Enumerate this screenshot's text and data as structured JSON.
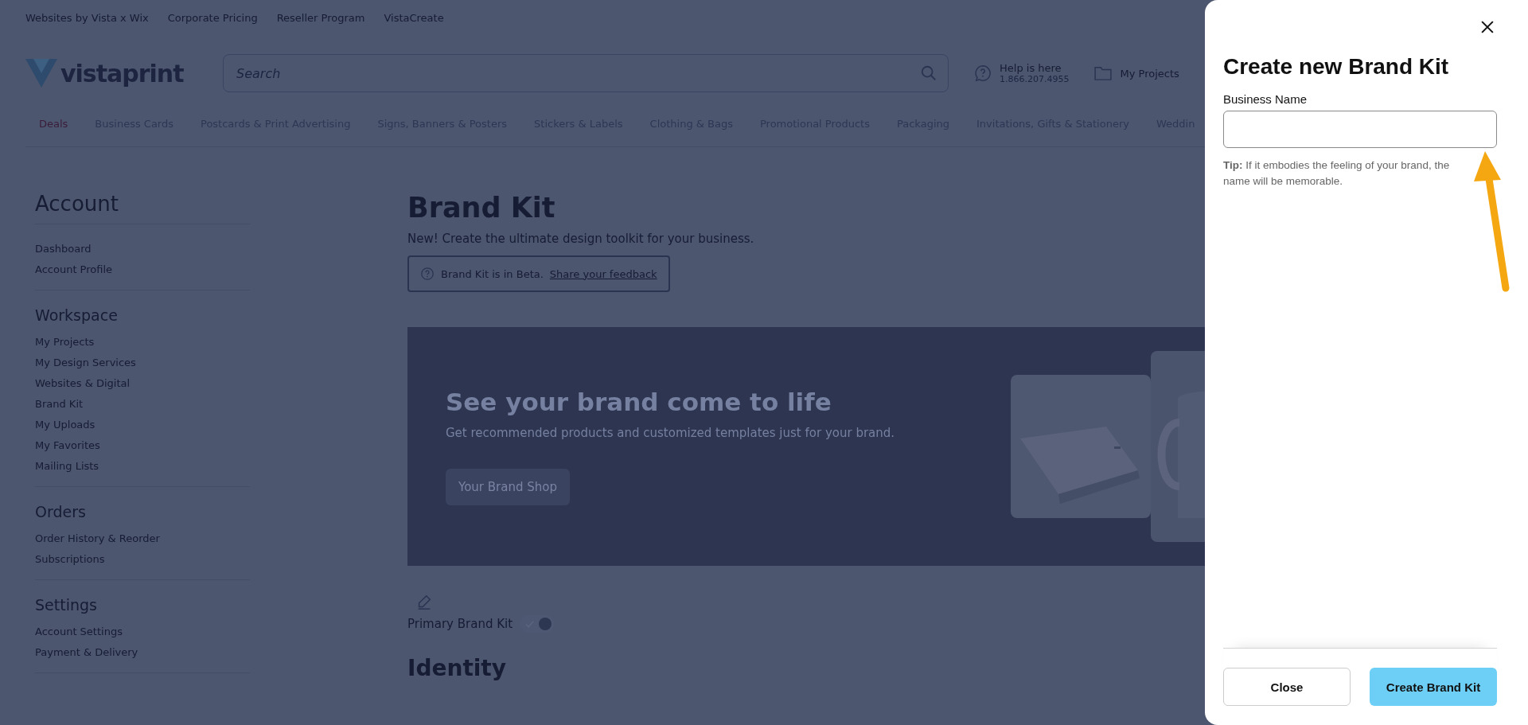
{
  "top_links": [
    "Websites by Vista x Wix",
    "Corporate Pricing",
    "Reseller Program",
    "VistaCreate"
  ],
  "header": {
    "logo": "vistaprint",
    "search": {
      "placeholder": "Search"
    },
    "help": {
      "title": "Help is here",
      "phone": "1.866.207.4955"
    },
    "projects": "My Projects"
  },
  "nav": [
    {
      "label": "Deals",
      "color": "#3a1c3a"
    },
    {
      "label": "Business Cards",
      "color": "#2d3754"
    },
    {
      "label": "Postcards & Print Advertising",
      "color": "#2d3754"
    },
    {
      "label": "Signs, Banners & Posters",
      "color": "#2d3754"
    },
    {
      "label": "Stickers & Labels",
      "color": "#2d3754"
    },
    {
      "label": "Clothing & Bags",
      "color": "#2d3754"
    },
    {
      "label": "Promotional Products",
      "color": "#2d3754"
    },
    {
      "label": "Packaging",
      "color": "#2d3754"
    },
    {
      "label": "Invitations, Gifts & Stationery",
      "color": "#2d3754"
    },
    {
      "label": "Weddin",
      "color": "#2d3754"
    }
  ],
  "sidebar": [
    {
      "title": "Account",
      "items": [
        "Dashboard",
        "Account Profile"
      ]
    },
    {
      "title": "Workspace",
      "items": [
        "My Projects",
        "My Design Services",
        "Websites & Digital",
        "Brand Kit",
        "My Uploads",
        "My Favorites",
        "Mailing Lists"
      ]
    },
    {
      "title": "Orders",
      "items": [
        "Order History & Reorder",
        "Subscriptions"
      ]
    },
    {
      "title": "Settings",
      "items": [
        "Account Settings",
        "Payment & Delivery"
      ]
    }
  ],
  "main": {
    "title": "Brand Kit",
    "subtitle": "New! Create the ultimate design toolkit for your business.",
    "beta_notice": {
      "text": "Brand Kit is in Beta.",
      "link": "Share your feedback"
    },
    "banner": {
      "title": "See your brand come to life",
      "text": "Get recommended products and customized templates just for your brand.",
      "button": "Your Brand Shop"
    },
    "primary_brand_kit": {
      "label": "Primary Brand Kit",
      "on": true
    },
    "section_title": "Identity"
  },
  "drawer": {
    "title": "Create new Brand Kit",
    "field_label": "Business Name",
    "tip_label": "Tip:",
    "tip": "If it embodies the feeling of your brand, the name will be memorable.",
    "buttons": [
      "Close",
      "Create Brand Kit"
    ]
  }
}
